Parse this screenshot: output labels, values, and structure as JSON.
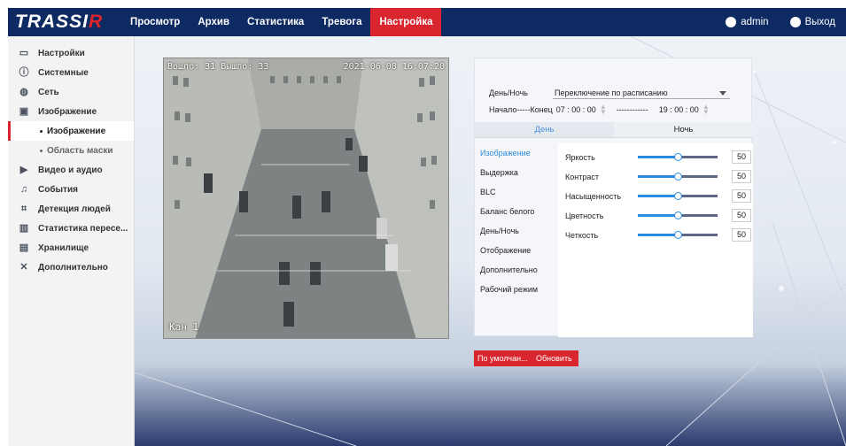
{
  "header": {
    "logo_main": "TRASSI",
    "logo_accent": "R",
    "nav": [
      {
        "label": "Просмотр"
      },
      {
        "label": "Архив"
      },
      {
        "label": "Статистика"
      },
      {
        "label": "Тревога"
      },
      {
        "label": "Настройка",
        "active": true
      }
    ],
    "user_label": "admin",
    "logout_label": "Выход"
  },
  "sidebar": {
    "items": [
      {
        "label": "Настройки",
        "icon": "monitor-icon"
      },
      {
        "label": "Системные",
        "icon": "info-icon"
      },
      {
        "label": "Сеть",
        "icon": "globe-icon"
      },
      {
        "label": "Изображение",
        "icon": "image-icon"
      },
      {
        "label": "Изображение",
        "sub": true,
        "active": true
      },
      {
        "label": "Область маски",
        "sub": true
      },
      {
        "label": "Видео и аудио",
        "icon": "video-icon"
      },
      {
        "label": "События",
        "icon": "bell-icon"
      },
      {
        "label": "Детекция людей",
        "icon": "person-detect-icon"
      },
      {
        "label": "Статистика пересе...",
        "icon": "stats-icon"
      },
      {
        "label": "Хранилище",
        "icon": "save-icon"
      },
      {
        "label": "Дополнительно",
        "icon": "tools-icon"
      }
    ]
  },
  "video": {
    "osd_top_left": "Вошло: 31 Вышло: 33",
    "osd_top_right": "2021-06-08 16:07:20",
    "osd_bottom_left": "Кан 1"
  },
  "panel": {
    "daynight_label": "День/Ночь",
    "daynight_value": "Переключение по расписанию",
    "range_label": "Начало-----Конец",
    "start_time": "07 : 00 : 00",
    "separator": "------------",
    "end_time": "19 : 00 : 00",
    "tabs": [
      {
        "label": "День",
        "active": true
      },
      {
        "label": "Ночь"
      }
    ],
    "menu": [
      {
        "label": "Изображение",
        "active": true
      },
      {
        "label": "Выдержка"
      },
      {
        "label": "BLC"
      },
      {
        "label": "Баланс белого"
      },
      {
        "label": "День/Ночь"
      },
      {
        "label": "Отображение"
      },
      {
        "label": "Дополнительно"
      },
      {
        "label": "Рабочий режим"
      }
    ],
    "sliders": [
      {
        "label": "Яркость",
        "value": "50"
      },
      {
        "label": "Контраст",
        "value": "50"
      },
      {
        "label": "Насыщенность",
        "value": "50"
      },
      {
        "label": "Цветность",
        "value": "50"
      },
      {
        "label": "Четкость",
        "value": "50"
      }
    ]
  },
  "buttons": {
    "default_label": "По умолчан...",
    "refresh_label": "Обновить"
  },
  "colors": {
    "header_bg": "#0d2a63",
    "accent_red": "#d9262e",
    "slider_blue": "#2c8be0"
  }
}
